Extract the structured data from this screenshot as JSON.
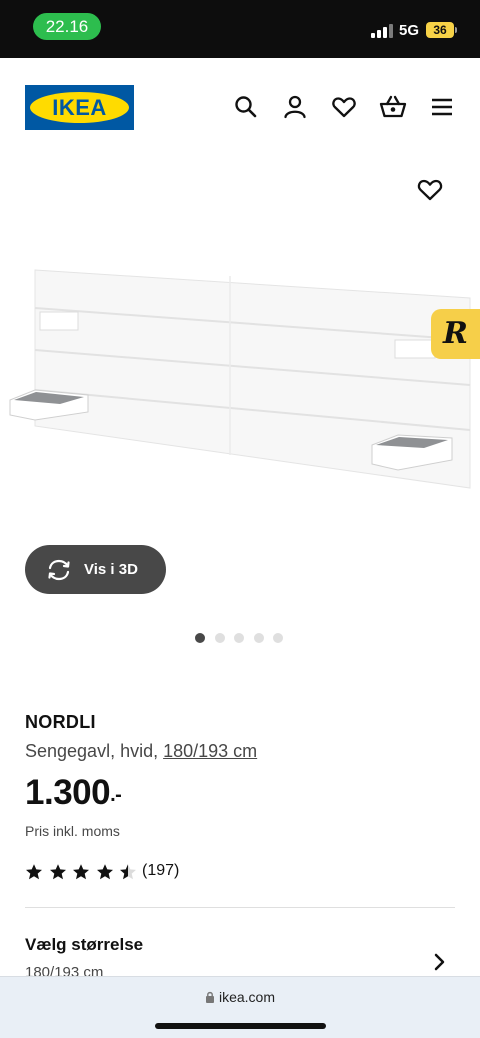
{
  "status_bar": {
    "time": "22.16",
    "network": "5G",
    "battery": "36"
  },
  "header": {
    "logo_text": "IKEA",
    "icons": [
      "search-icon",
      "user-icon",
      "heart-icon",
      "basket-icon",
      "menu-icon"
    ]
  },
  "gallery": {
    "view_3d_label": "Vis i 3D",
    "badge_letter": "R",
    "page_count": 5,
    "active_page": 1
  },
  "product": {
    "name": "NORDLI",
    "description_prefix": "Sengegavl, hvid, ",
    "size_link": "180/193 cm",
    "price": "1.300",
    "price_suffix": ".-",
    "price_note": "Pris inkl. moms",
    "rating_value": 4.5,
    "rating_max": 5,
    "review_count": "(197)"
  },
  "size_section": {
    "title": "Vælg størrelse",
    "current": "180/193 cm"
  },
  "browser": {
    "url": "ikea.com"
  },
  "colors": {
    "ikea_blue": "#0058a3",
    "ikea_yellow": "#ffdb00",
    "status_green": "#2dbd4e",
    "badge_yellow": "#f6cf49"
  }
}
